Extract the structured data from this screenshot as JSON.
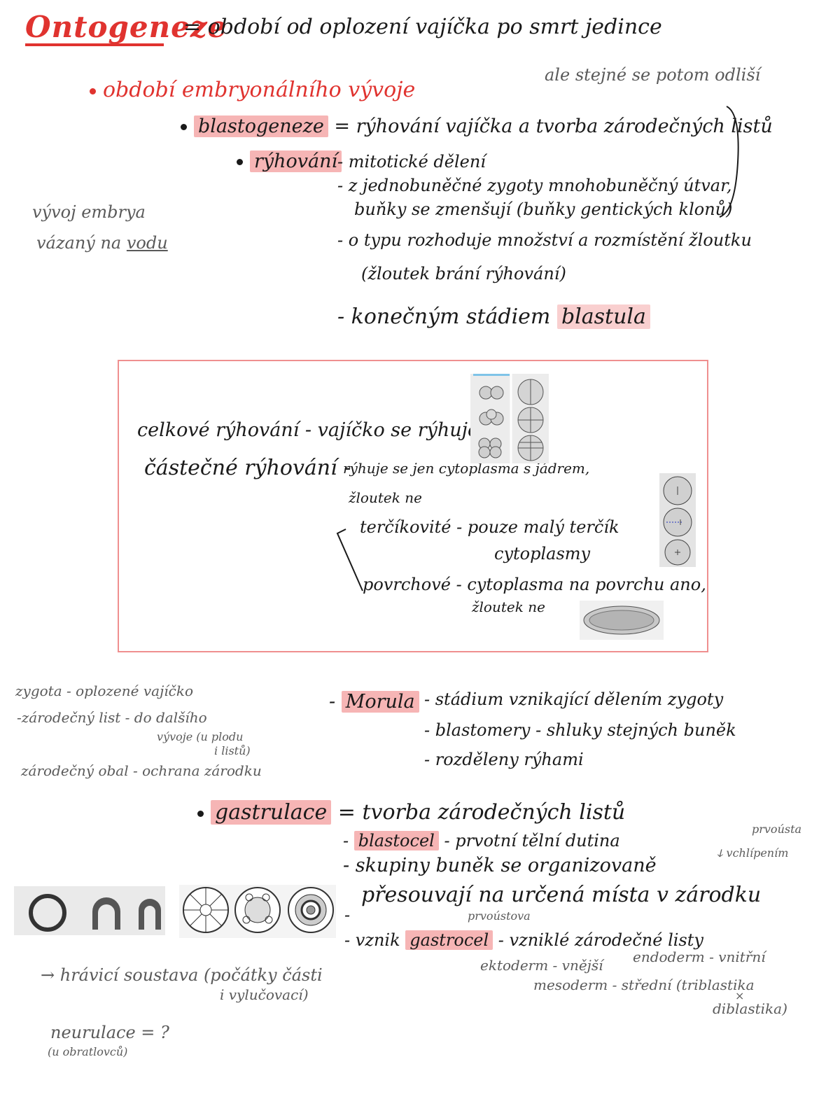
{
  "title": "Ontogeneze",
  "definition": "= období od oplození vajíčka po smrt jedince",
  "embryo_period": "období embryonálního vývoje",
  "side_note_top": "ale stejné se potom odliší",
  "blastogeneze": {
    "term": "blastogeneze",
    "definition": "= rýhování vajíčka a tvorba zárodečných listů"
  },
  "ryhovani": {
    "term": "rýhování",
    "lines": [
      "- mitotické dělení",
      "- z jednobuněčné zygoty mnohobuněčný útvar,",
      "buňky se zmenšují (buňky gentických klonů)",
      "- o typu rozhoduje množství a rozmístění žloutku",
      "(žloutek brání rýhování)",
      "- konečným stádiem"
    ],
    "blastula": "blastula"
  },
  "left_note": {
    "line1": "vývoj embrya",
    "line2": "vázaný na",
    "underlined": "vodu"
  },
  "box": {
    "celkove": "celkové rýhování - vajíčko se rýhuje celé",
    "castecne": "částečné rýhování -",
    "castecne_desc1": "rýhuje se jen cytoplasma s jádrem,",
    "castecne_desc2": "žloutek ne",
    "terckovite": "terčíkovité - pouze malý terčík",
    "terckovite_2": "cytoplasmy",
    "povrchove": "povrchové - cytoplasma na povrchu ano,",
    "povrchove_2": "žloutek ne"
  },
  "definitions_left": {
    "zygota": "zygota - oplozené vajíčko",
    "zarodecny_list": "-zárodečný list - do dalšího",
    "zarodecny_list_2": "vývoje (u plodu",
    "zarodecny_list_3": "i listů)",
    "zarodecny_obal": "zárodečný obal - ochrana zárodku"
  },
  "morula": {
    "term": "Morula",
    "lines": [
      "- stádium vznikající dělením zygoty",
      "- blastomery - shluky stejných buněk",
      "- rozděleny rýhami"
    ]
  },
  "gastrulace": {
    "term": "gastrulace",
    "definition": "= tvorba zárodečných listů",
    "blastocel_term": "blastocel",
    "blastocel_desc": "- prvotní tělní dutina",
    "blastocel_note1": "prvoústa",
    "blastocel_note2": "ↆ vchlípením",
    "line_skupiny": "- skupiny buněk se organizovaně",
    "line_presouvaji": "přesouvají na určená místa v zárodku",
    "prvoustova": "prvoústova",
    "vznik": "- vznik",
    "gastrocel": "gastrocel",
    "zarodecne_listy": "- vzniklé zárodečné listy",
    "ektoderm": "ektoderm - vnější",
    "endoderm": "endoderm - vnitřní",
    "mesoderm": "mesoderm - střední (triblastika",
    "x": "×",
    "diblastika": "diblastika)"
  },
  "bottom": {
    "arrow_note": "→ hrávicí soustava (počátky části",
    "arrow_note_2": "i vylučovací)",
    "neurulace": "neurulace = ?",
    "neurulace_2": "(u obratlovců)"
  },
  "colors": {
    "red_ink": "#e0332f",
    "highlight": "#f6b5b5",
    "box_border": "#ef8f8f"
  }
}
